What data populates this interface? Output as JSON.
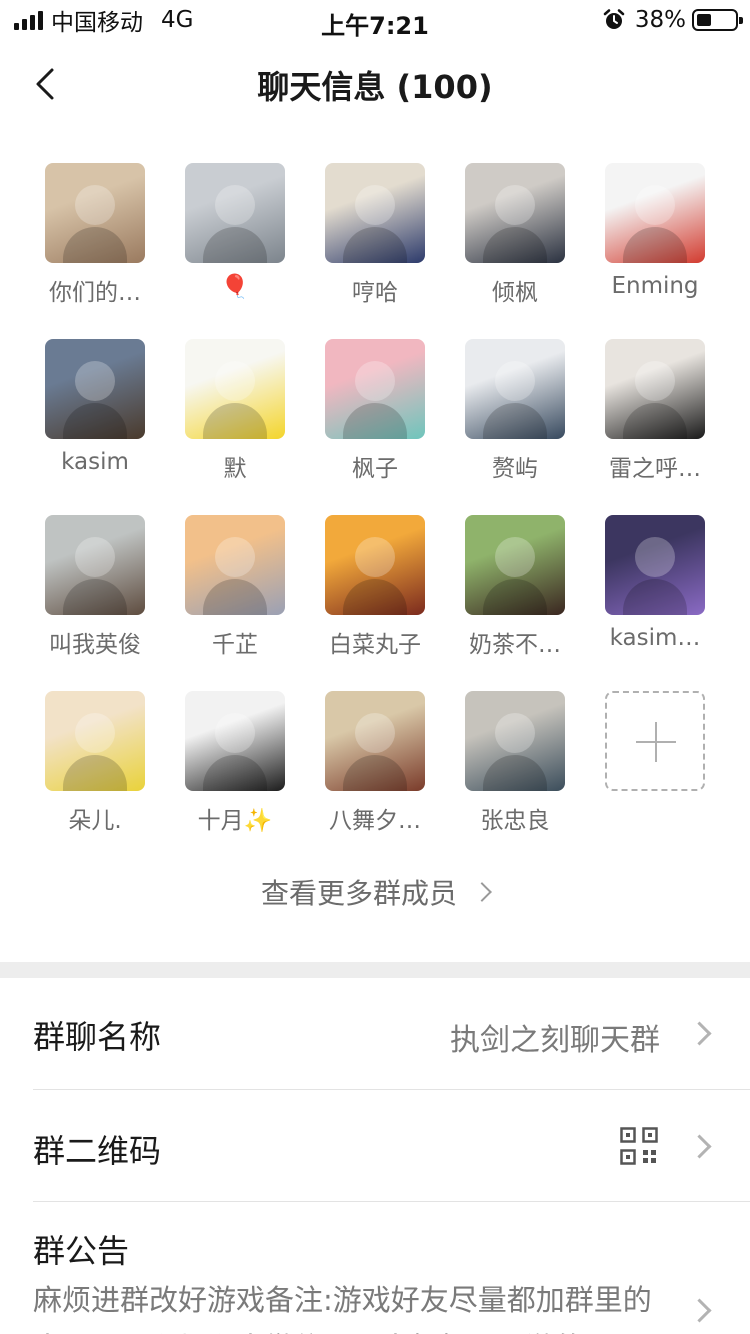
{
  "status_bar": {
    "carrier": "中国移动",
    "network": "4G",
    "time": "上午7:21",
    "battery": "38%",
    "battery_level": 0.38
  },
  "nav": {
    "title": "聊天信息 (100)"
  },
  "members": [
    {
      "name": "你们的…",
      "avatar": "selfie-photo",
      "colors": [
        "#d7c3a8",
        "#9a7a5f"
      ]
    },
    {
      "name": "🎈",
      "avatar": "seaside-photo",
      "colors": [
        "#c9cdd2",
        "#7c848c"
      ]
    },
    {
      "name": "哼哈",
      "avatar": "suit-man-photo",
      "colors": [
        "#e3dccf",
        "#2c3a6b"
      ]
    },
    {
      "name": "倾枫",
      "avatar": "man-portrait-photo",
      "colors": [
        "#cfcbc6",
        "#2a3140"
      ]
    },
    {
      "name": "Enming",
      "avatar": "cartoon-boy-red-hat",
      "colors": [
        "#f4f4f4",
        "#d23b2f"
      ]
    },
    {
      "name": "kasim",
      "avatar": "otter-photo",
      "colors": [
        "#6a7b93",
        "#4a3a2c"
      ]
    },
    {
      "name": "默",
      "avatar": "pikachu-drawing",
      "colors": [
        "#f7f7f2",
        "#f4d52b"
      ]
    },
    {
      "name": "枫子",
      "avatar": "two-women-illustration",
      "colors": [
        "#f1b7c0",
        "#6ec5bc"
      ]
    },
    {
      "name": "赘屿",
      "avatar": "anime-warrior",
      "colors": [
        "#e9ebee",
        "#37495e"
      ]
    },
    {
      "name": "雷之呼…",
      "avatar": "pepsi-cat-photo",
      "colors": [
        "#e8e4df",
        "#1a1a1a"
      ]
    },
    {
      "name": "叫我英俊",
      "avatar": "dog-window-photo",
      "colors": [
        "#bfc3c2",
        "#5e4c3f"
      ]
    },
    {
      "name": "千芷",
      "avatar": "anime-girl-silver",
      "colors": [
        "#f2c08a",
        "#9aa0b4"
      ]
    },
    {
      "name": "白菜丸子",
      "avatar": "anime-boy-red",
      "colors": [
        "#f2a93b",
        "#7b2a1e"
      ]
    },
    {
      "name": "奶茶不…",
      "avatar": "woman-selfie-photo",
      "colors": [
        "#8fb36b",
        "#3a2620"
      ]
    },
    {
      "name": "kasim…",
      "avatar": "anime-purple-boy",
      "colors": [
        "#3c3660",
        "#8a6ac4"
      ]
    },
    {
      "name": "朵儿.",
      "avatar": "dog-crown-photo",
      "colors": [
        "#f2e2c8",
        "#e9d23a"
      ]
    },
    {
      "name": "十月✨",
      "avatar": "anime-boy-sketch",
      "colors": [
        "#f2f2f2",
        "#1c1c1c"
      ]
    },
    {
      "name": "八舞夕…",
      "avatar": "anime-dress-girl",
      "colors": [
        "#d9c8a8",
        "#7a3b2a"
      ]
    },
    {
      "name": "张忠良",
      "avatar": "man-microscope-photo",
      "colors": [
        "#c6c3bc",
        "#3b4d5b"
      ]
    }
  ],
  "add_member": {
    "icon": "plus-icon"
  },
  "more_members_label": "查看更多群成员",
  "settings": {
    "group_name_label": "群聊名称",
    "group_name_value": "执剑之刻聊天群",
    "qr_label": "群二维码",
    "notice_label": "群公告",
    "notice_text": "麻烦进群改好游戏备注:游戏好友尽量都加群里的人，不要私加私人微信喂，人机机不玩游的"
  }
}
